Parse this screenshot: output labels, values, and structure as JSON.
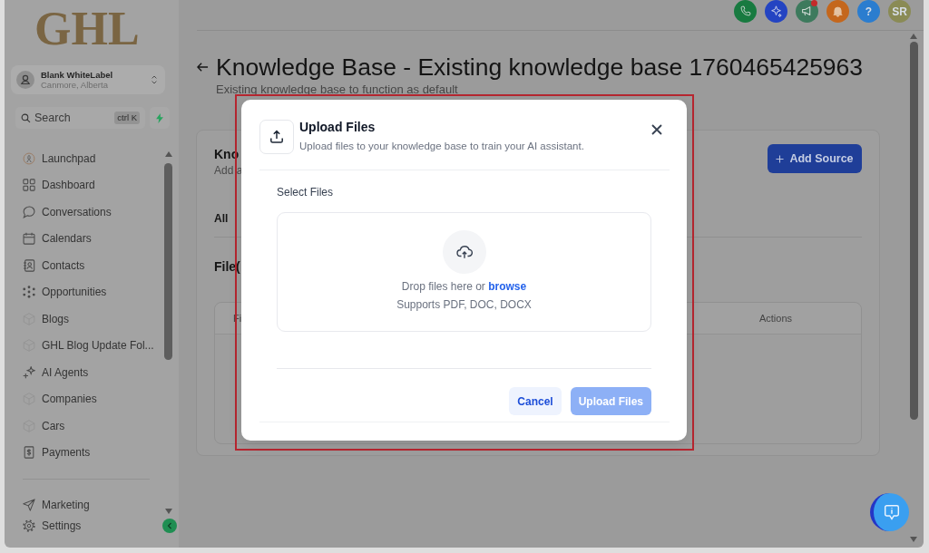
{
  "sidebar": {
    "logo": "GHL",
    "account": {
      "name": "Blank WhiteLabel",
      "location": "Canmore, Alberta"
    },
    "search": {
      "placeholder": "Search",
      "shortcut": "ctrl K"
    },
    "nav_items": [
      {
        "label": "Launchpad",
        "kind": "launchpad",
        "selected": false
      },
      {
        "label": "Dashboard",
        "kind": "dashboard",
        "selected": false
      },
      {
        "label": "Conversations",
        "kind": "conversations",
        "selected": false
      },
      {
        "label": "Calendars",
        "kind": "calendars",
        "selected": false
      },
      {
        "label": "Contacts",
        "kind": "contacts",
        "selected": false
      },
      {
        "label": "Opportunities",
        "kind": "opportunities",
        "selected": false
      },
      {
        "label": "Blogs",
        "kind": "custom",
        "selected": false
      },
      {
        "label": "GHL Blog Update Fol...",
        "kind": "custom",
        "selected": false
      },
      {
        "label": "AI Agents",
        "kind": "ai_agents",
        "selected": false
      },
      {
        "label": "Companies",
        "kind": "custom",
        "selected": false
      },
      {
        "label": "Cars",
        "kind": "custom",
        "selected": false
      },
      {
        "label": "Payments",
        "kind": "payments",
        "selected": false
      }
    ],
    "bottom_items": [
      {
        "label": "Marketing",
        "kind": "marketing",
        "selected": false
      },
      {
        "label": "Settings",
        "kind": "settings",
        "selected": false
      }
    ]
  },
  "header_actions": [
    {
      "kind": "phone",
      "notification": false
    },
    {
      "kind": "sparkle",
      "notification": false
    },
    {
      "kind": "megaphone",
      "notification": true
    },
    {
      "kind": "bell",
      "notification": false
    },
    {
      "kind": "help",
      "label": "?",
      "notification": false
    },
    {
      "kind": "avatar",
      "label": "SR",
      "notification": false
    }
  ],
  "page": {
    "title": "Knowledge Base - Existing knowledge base 1760465425963",
    "subtitle": "Existing knowledge base to function as default",
    "card": {
      "heading": "Kno",
      "description": "Add a",
      "add_button": "Add Source",
      "tabs": [
        {
          "label": "All",
          "selected": true
        }
      ],
      "section_title": "File(",
      "table": {
        "columns": [
          "Fi",
          "Actions"
        ]
      }
    }
  },
  "modal": {
    "title": "Upload Files",
    "subtitle": "Upload files to your knowledge base to train your AI assistant.",
    "field_label": "Select Files",
    "dropzone": {
      "text": "Drop files here or ",
      "link": "browse",
      "hint": "Supports PDF, DOC, DOCX"
    },
    "buttons": [
      {
        "label": "Cancel",
        "kind": "secondary",
        "disabled": false
      },
      {
        "label": "Upload Files",
        "kind": "primary",
        "disabled": true
      }
    ]
  }
}
